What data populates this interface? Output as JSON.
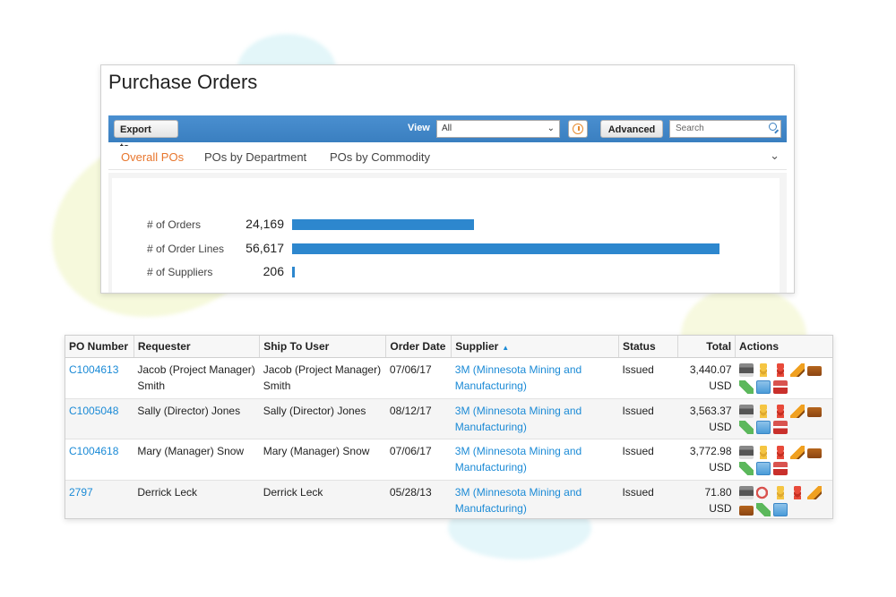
{
  "page": {
    "title": "Purchase Orders"
  },
  "toolbar": {
    "export_label": "Export to",
    "view_label": "View",
    "view_value": "All",
    "advanced_label": "Advanced",
    "search_placeholder": "Search"
  },
  "tabs": [
    {
      "label": "Overall POs",
      "active": true
    },
    {
      "label": "POs by Department",
      "active": false
    },
    {
      "label": "POs by Commodity",
      "active": false
    }
  ],
  "stats": [
    {
      "label": "# of Orders",
      "value": "24,169",
      "fraction": 0.2584
    },
    {
      "label": "# of Order Lines",
      "value": "56,617",
      "fraction": 0.6055
    },
    {
      "label": "# of Suppliers",
      "value": "206",
      "fraction": 0.0032
    }
  ],
  "stats_scale_max": 93500,
  "table": {
    "headers": {
      "po_number": "PO Number",
      "requester": "Requester",
      "ship_to": "Ship To User",
      "order_date": "Order Date",
      "supplier": "Supplier",
      "status": "Status",
      "total": "Total",
      "actions": "Actions"
    },
    "rows": [
      {
        "po": "C1004613",
        "requester": "Jacob (Project Manager) Smith",
        "ship_to": "Jacob (Project Manager) Smith",
        "date": "07/06/17",
        "supplier": "3M (Minnesota Mining and Manufacturing)",
        "status": "Issued",
        "amount": "3,440.07",
        "currency": "USD",
        "icons": [
          "printer-icon",
          "coins-icon",
          "red-coins-icon",
          "pencil-icon",
          "truck-icon",
          "send-icon",
          "receive-icon",
          "return-icon"
        ]
      },
      {
        "po": "C1005048",
        "requester": "Sally (Director) Jones",
        "ship_to": "Sally (Director) Jones",
        "date": "08/12/17",
        "supplier": "3M (Minnesota Mining and Manufacturing)",
        "status": "Issued",
        "amount": "3,563.37",
        "currency": "USD",
        "icons": [
          "printer-icon",
          "coins-icon",
          "red-coins-icon",
          "pencil-icon",
          "truck-icon",
          "send-icon",
          "receive-icon",
          "return-icon"
        ]
      },
      {
        "po": "C1004618",
        "requester": "Mary (Manager) Snow",
        "ship_to": "Mary (Manager) Snow",
        "date": "07/06/17",
        "supplier": "3M (Minnesota Mining and Manufacturing)",
        "status": "Issued",
        "amount": "3,772.98",
        "currency": "USD",
        "icons": [
          "printer-icon",
          "coins-icon",
          "red-coins-icon",
          "pencil-icon",
          "truck-icon",
          "send-icon",
          "receive-icon",
          "return-icon"
        ]
      },
      {
        "po": "2797",
        "requester": "Derrick Leck",
        "ship_to": "Derrick Leck",
        "date": "05/28/13",
        "supplier": "3M (Minnesota Mining and Manufacturing)",
        "status": "Issued",
        "amount": "71.80",
        "currency": "USD",
        "icons": [
          "printer-icon",
          "undo-icon",
          "coins-icon",
          "red-coins-icon",
          "pencil-icon",
          "truck-icon",
          "send-icon",
          "receive-icon"
        ]
      }
    ]
  }
}
